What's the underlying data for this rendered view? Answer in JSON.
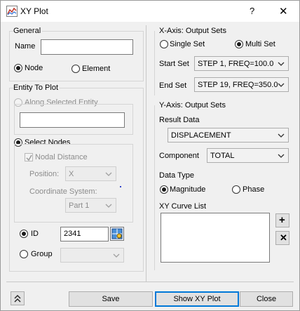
{
  "window": {
    "title": "XY Plot",
    "help_label": "?",
    "close_label": "✕"
  },
  "general": {
    "legend": "General",
    "name_label": "Name",
    "name_value": "",
    "node_label": "Node",
    "element_label": "Element",
    "selected": "Node"
  },
  "entity": {
    "legend": "Entity To Plot",
    "along_label": "Along Selected Entity",
    "along_value": "",
    "select_nodes_label": "Select Nodes",
    "nodal_distance_label": "Nodal Distance",
    "position_label": "Position:",
    "position_value": "X",
    "coord_label": "Coordinate System:",
    "coord_value": "Part 1",
    "id_label": "ID",
    "id_value": "2341",
    "group_label": "Group",
    "group_value": ""
  },
  "x_axis": {
    "legend": "X-Axis: Output Sets",
    "single_label": "Single Set",
    "multi_label": "Multi Set",
    "selected": "Multi Set",
    "start_label": "Start Set",
    "start_value": "STEP 1, FREQ=100.0",
    "end_label": "End Set",
    "end_value": "STEP 19, FREQ=350.0"
  },
  "y_axis": {
    "legend": "Y-Axis: Output Sets",
    "result_label": "Result Data",
    "result_value": "DISPLACEMENT",
    "component_label": "Component",
    "component_value": "TOTAL",
    "datatype_label": "Data Type",
    "magnitude_label": "Magnitude",
    "phase_label": "Phase",
    "selected": "Magnitude",
    "curve_list_label": "XY Curve List",
    "add_label": "+",
    "remove_label": "✕"
  },
  "footer": {
    "save_label": "Save",
    "show_label": "Show XY Plot",
    "close_label": "Close"
  }
}
